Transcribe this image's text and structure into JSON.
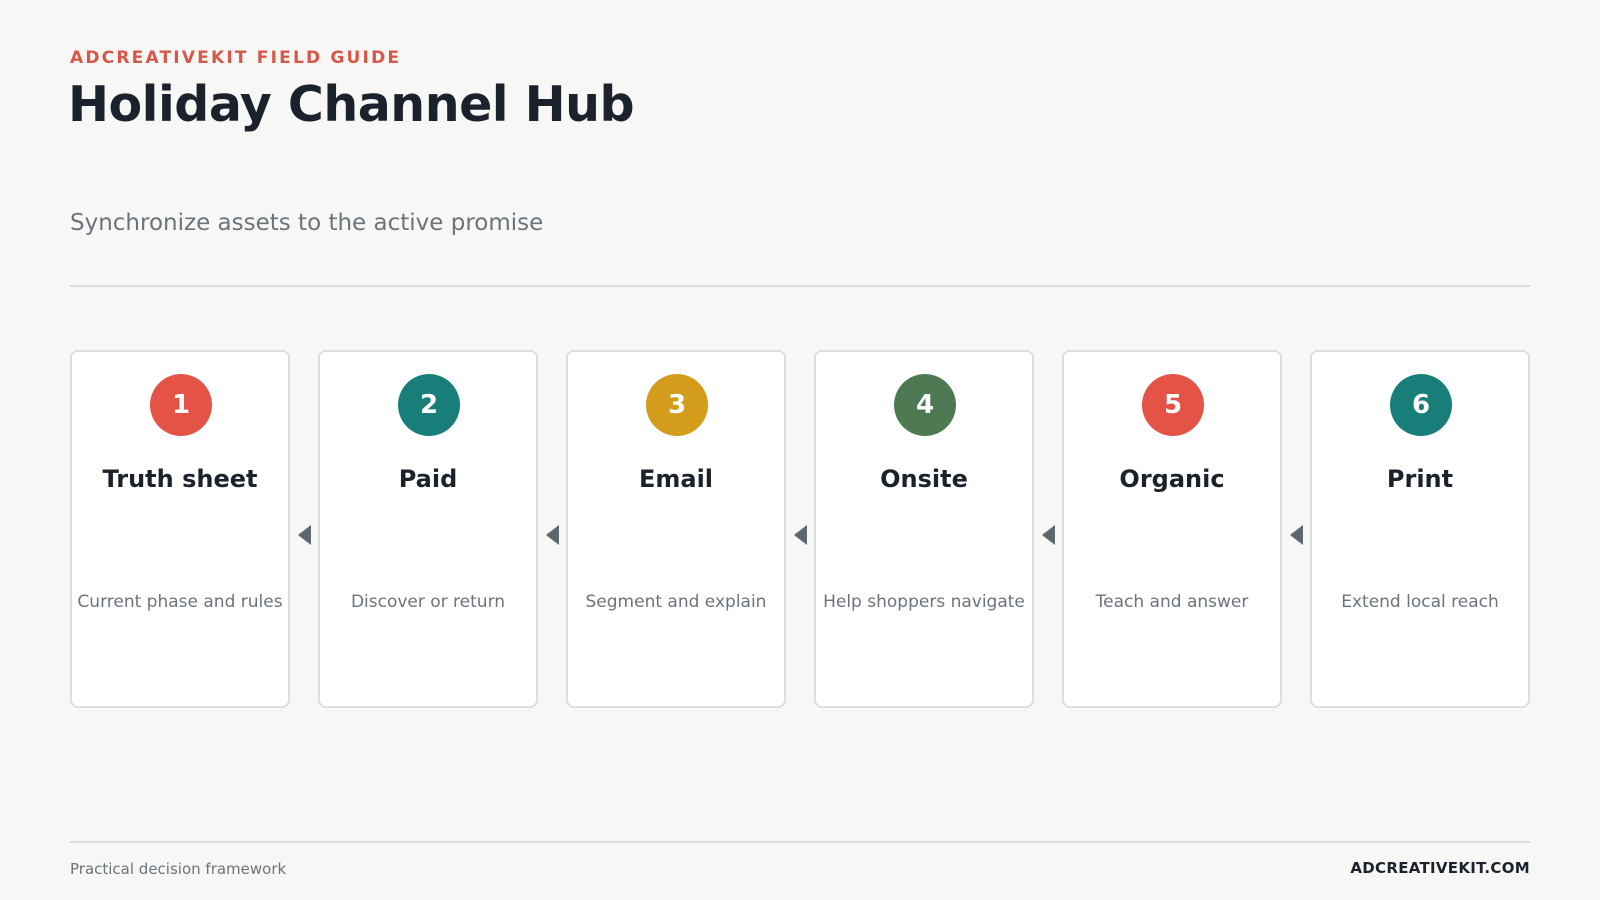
{
  "header": {
    "eyebrow": "ADCREATIVEKIT FIELD GUIDE",
    "title": "Holiday Channel Hub",
    "subtitle": "Synchronize assets to the active promise"
  },
  "steps": [
    {
      "number": "1",
      "title": "Truth sheet",
      "description": "Current phase and rules",
      "color": "#e55346"
    },
    {
      "number": "2",
      "title": "Paid",
      "description": "Discover or return",
      "color": "#177e7a"
    },
    {
      "number": "3",
      "title": "Email",
      "description": "Segment and explain",
      "color": "#d39c1b"
    },
    {
      "number": "4",
      "title": "Onsite",
      "description": "Help shoppers navigate",
      "color": "#4d7a52"
    },
    {
      "number": "5",
      "title": "Organic",
      "description": "Teach and answer",
      "color": "#e55346"
    },
    {
      "number": "6",
      "title": "Print",
      "description": "Extend local reach",
      "color": "#177e7a"
    }
  ],
  "connector_icon": "arrow-left-icon",
  "footer": {
    "left": "Practical decision framework",
    "right": "ADCREATIVEKIT.COM"
  }
}
